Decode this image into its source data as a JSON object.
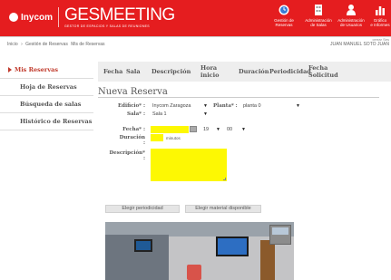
{
  "header": {
    "brand": "Inycom",
    "app_title": "GESMEETING",
    "app_subtitle": "GESTOR DE ESPACIOS Y SALAS DE REUNIONES",
    "modules": [
      {
        "icon": "clock-icon",
        "line1": "Gestión de",
        "line2": "Reservas"
      },
      {
        "icon": "building-icon",
        "line1": "Administración",
        "line2": "de Salas"
      },
      {
        "icon": "user-icon",
        "line1": "Administración",
        "line2": "de Usuarios"
      },
      {
        "icon": "bar-chart-icon",
        "line1": "Gráfico",
        "line2": "e Informes"
      }
    ]
  },
  "top_right_link": "cerrar Ses",
  "breadcrumb": {
    "items": [
      "Inicio",
      "›",
      "Gestión de Reservas",
      "Mis de Reservas"
    ]
  },
  "user": "JUAN MANUEL SOTO JUAN",
  "sidebar": {
    "items": [
      {
        "label": "Mis Reservas"
      },
      {
        "label": "Hoja de Reservas"
      },
      {
        "label": "Búsqueda de salas"
      },
      {
        "label": "Histórico de Reservas"
      }
    ]
  },
  "table": {
    "columns": [
      "Fecha",
      "Sala",
      "Descripción",
      "Hora inicio",
      "Duración",
      "Periodicidad",
      "Fecha Solicitud"
    ]
  },
  "form": {
    "title": "Nueva Reserva",
    "edificio_label": "Edificio* :",
    "edificio_value": "Inycom Zaragoza",
    "planta_label": "Planta* :",
    "planta_value": "planta 0",
    "sala_label": "Sala* :",
    "sala_value": "Sala 1",
    "fecha_label": "Fecha* :",
    "fecha_value": "",
    "hour_value": "19",
    "minute_value": "00",
    "duracion_label": "Duración :",
    "duracion_value": "",
    "minutes_unit": "minutos",
    "descripcion_label": "Descripción* :",
    "descripcion_value": "",
    "btn_periodicidad": "Elegir periodicidad",
    "btn_material": "Elegir material disponible"
  },
  "colors": {
    "header_bg": "#e51d1f",
    "required_field": "#fdf803",
    "accent_text": "#c0392b"
  }
}
